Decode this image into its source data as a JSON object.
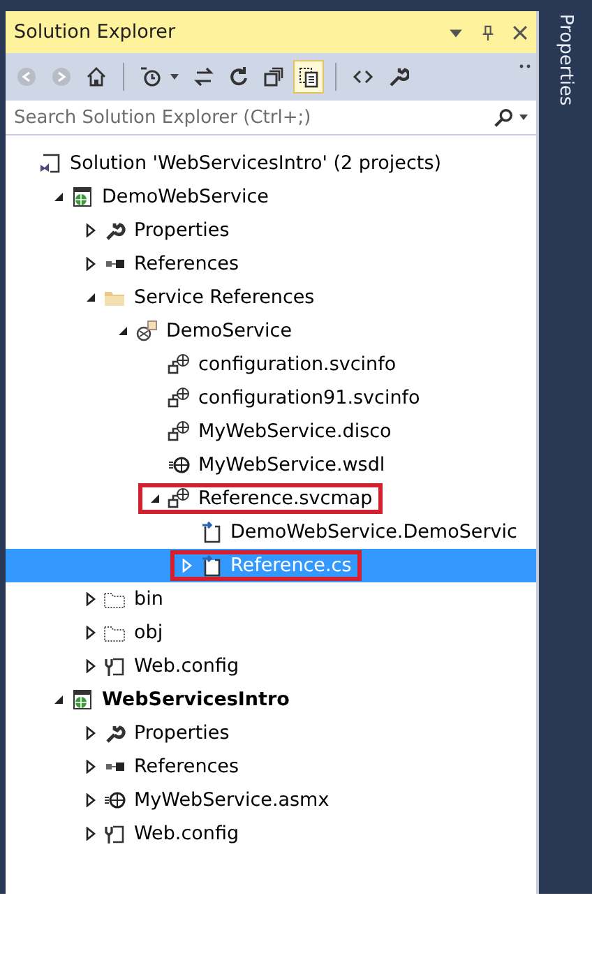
{
  "panel": {
    "title": "Solution Explorer",
    "side_tab": "Properties"
  },
  "toolbar": [
    {
      "kind": "back",
      "active": false
    },
    {
      "kind": "forward",
      "active": false
    },
    {
      "kind": "home",
      "active": false
    },
    {
      "kind": "separator"
    },
    {
      "kind": "history",
      "active": false
    },
    {
      "kind": "sync",
      "active": false
    },
    {
      "kind": "refresh",
      "active": false
    },
    {
      "kind": "collapse",
      "active": false
    },
    {
      "kind": "show-all",
      "active": true
    },
    {
      "kind": "separator"
    },
    {
      "kind": "code",
      "active": false
    },
    {
      "kind": "properties",
      "active": false
    }
  ],
  "search": {
    "placeholder": "Search Solution Explorer (Ctrl+;)"
  },
  "tree": [
    {
      "label": "Solution 'WebServicesIntro' (2 projects)",
      "kind": "solution",
      "selected": false,
      "marked": false,
      "bold": false,
      "children": [
        {
          "label": "DemoWebService",
          "kind": "web-project",
          "expanded": true,
          "selected": false,
          "marked": false,
          "bold": false,
          "children": [
            {
              "label": "Properties",
              "kind": "wrench",
              "expanded": false,
              "selected": false,
              "marked": false,
              "bold": false
            },
            {
              "label": "References",
              "kind": "references",
              "expanded": false,
              "selected": false,
              "marked": false,
              "bold": false
            },
            {
              "label": "Service References",
              "kind": "folder",
              "expanded": true,
              "selected": false,
              "marked": false,
              "bold": false,
              "children": [
                {
                  "label": "DemoService",
                  "kind": "service",
                  "expanded": true,
                  "selected": false,
                  "marked": false,
                  "bold": false,
                  "children": [
                    {
                      "label": "configuration.svcinfo",
                      "kind": "svcfile",
                      "selected": false,
                      "marked": false,
                      "bold": false
                    },
                    {
                      "label": "configuration91.svcinfo",
                      "kind": "svcfile",
                      "selected": false,
                      "marked": false,
                      "bold": false
                    },
                    {
                      "label": "MyWebService.disco",
                      "kind": "svcfile",
                      "selected": false,
                      "marked": false,
                      "bold": false
                    },
                    {
                      "label": "MyWebService.wsdl",
                      "kind": "wsdl",
                      "selected": false,
                      "marked": false,
                      "bold": false
                    },
                    {
                      "label": "Reference.svcmap",
                      "kind": "svcfile",
                      "expanded": true,
                      "selected": false,
                      "marked": true,
                      "bold": false,
                      "children": [
                        {
                          "label": "DemoWebService.DemoServic",
                          "kind": "codefile",
                          "selected": false,
                          "marked": false,
                          "bold": false
                        },
                        {
                          "label": "Reference.cs",
                          "kind": "codefile",
                          "expanded": false,
                          "selected": true,
                          "marked": true,
                          "bold": false
                        }
                      ]
                    }
                  ]
                }
              ]
            },
            {
              "label": "bin",
              "kind": "dotted-folder",
              "expanded": false,
              "selected": false,
              "marked": false,
              "bold": false
            },
            {
              "label": "obj",
              "kind": "dotted-folder",
              "expanded": false,
              "selected": false,
              "marked": false,
              "bold": false
            },
            {
              "label": "Web.config",
              "kind": "config",
              "expanded": false,
              "selected": false,
              "marked": false,
              "bold": false
            }
          ]
        },
        {
          "label": "WebServicesIntro",
          "kind": "web-project",
          "expanded": true,
          "selected": false,
          "marked": false,
          "bold": true,
          "children": [
            {
              "label": "Properties",
              "kind": "wrench",
              "expanded": false,
              "selected": false,
              "marked": false,
              "bold": false
            },
            {
              "label": "References",
              "kind": "references",
              "expanded": false,
              "selected": false,
              "marked": false,
              "bold": false
            },
            {
              "label": "MyWebService.asmx",
              "kind": "wsdl",
              "expanded": false,
              "selected": false,
              "marked": false,
              "bold": false
            },
            {
              "label": "Web.config",
              "kind": "config",
              "expanded": false,
              "selected": false,
              "marked": false,
              "bold": false
            }
          ]
        }
      ]
    }
  ]
}
